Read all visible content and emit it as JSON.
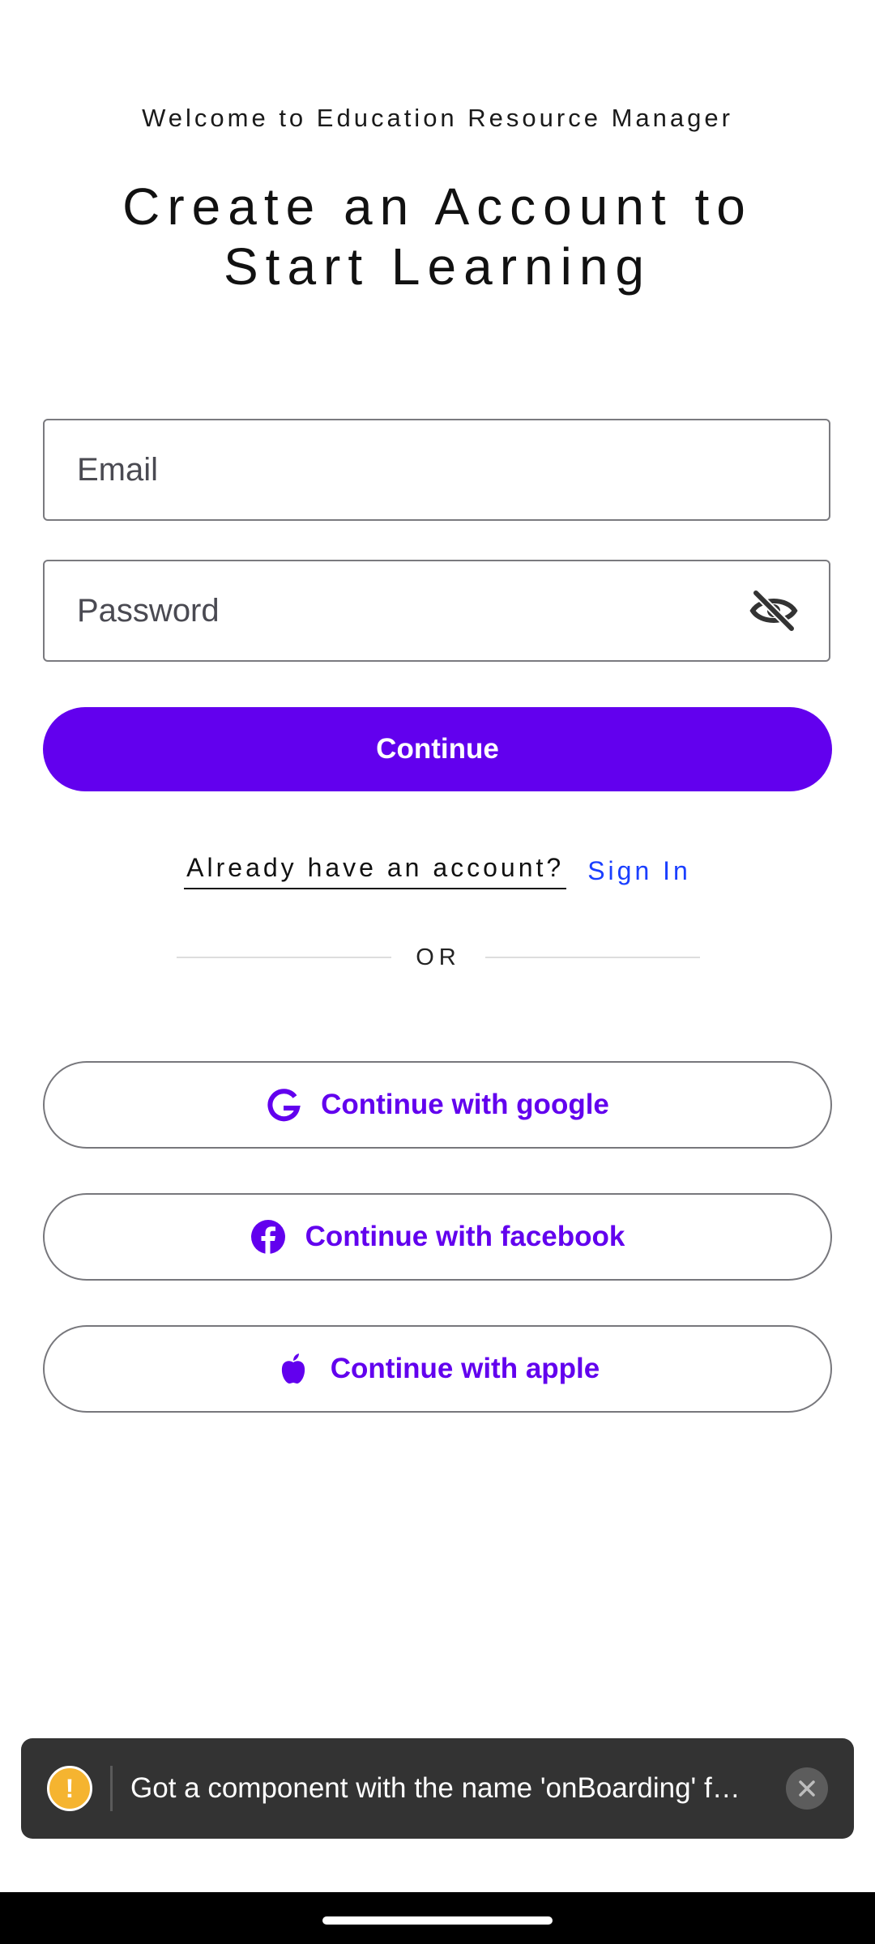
{
  "header": {
    "welcome": "Welcome to Education Resource Manager",
    "headline_line1": "Create an Account to",
    "headline_line2": "Start Learning"
  },
  "form": {
    "email_placeholder": "Email",
    "password_placeholder": "Password",
    "password_toggle_icon": "eye-off-icon",
    "continue_label": "Continue"
  },
  "signin": {
    "prompt": "Already have an account?",
    "link": "Sign In"
  },
  "divider": {
    "label": "OR"
  },
  "social": [
    {
      "label": "Continue with google",
      "icon": "google-icon"
    },
    {
      "label": "Continue with facebook",
      "icon": "facebook-icon"
    },
    {
      "label": "Continue with apple",
      "icon": "apple-icon"
    }
  ],
  "toast": {
    "message": "Got a component with the name 'onBoarding' f…",
    "icon": "warning-icon"
  },
  "colors": {
    "primary": "#6200ee",
    "link": "#1a3fff",
    "toast_bg": "#333333",
    "warning": "#f5b430"
  }
}
